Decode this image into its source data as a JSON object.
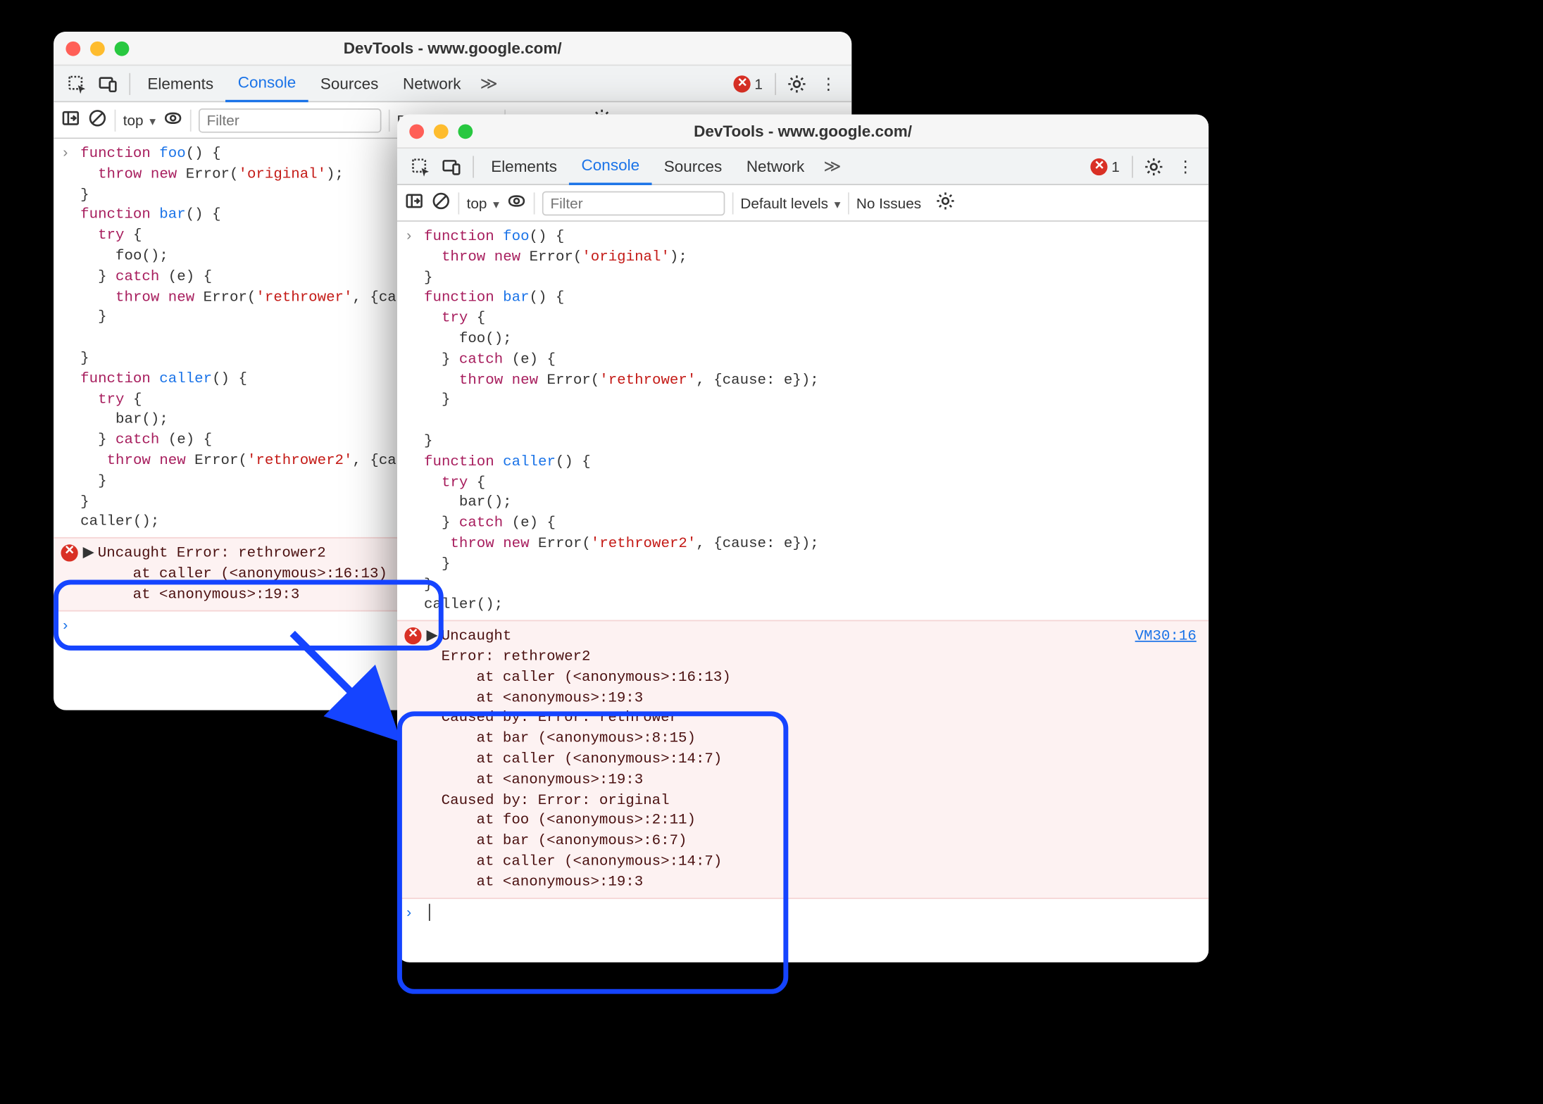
{
  "window_title": "DevTools - www.google.com/",
  "tabs": {
    "elements": "Elements",
    "console": "Console",
    "sources": "Sources",
    "network": "Network"
  },
  "error_count": "1",
  "filterbar": {
    "context": "top",
    "filter_placeholder": "Filter",
    "levels": "Default levels",
    "issues": "No Issues"
  },
  "code": {
    "l01": "function foo() {",
    "l02": "  throw new Error('original');",
    "l03": "}",
    "l04": "function bar() {",
    "l05": "  try {",
    "l06": "    foo();",
    "l07": "  } catch (e) {",
    "l08": "    throw new Error('rethrower', {cause: e});",
    "l09": "  }",
    "l10": "",
    "l11": "}",
    "l12": "function caller() {",
    "l13": "  try {",
    "l14": "    bar();",
    "l15": "  } catch (e) {",
    "l16": "   throw new Error('rethrower2', {cause: e});",
    "l17": "  }",
    "l18": "}",
    "l19": "caller();"
  },
  "error_left": {
    "line1": "Uncaught Error: rethrower2",
    "line2": "    at caller (<anonymous>:16:13)",
    "line3": "    at <anonymous>:19:3"
  },
  "error_right": {
    "link": "VM30:16",
    "line01": "Uncaught ",
    "line02": "Error: rethrower2",
    "line03": "    at caller (<anonymous>:16:13)",
    "line04": "    at <anonymous>:19:3",
    "line05": "Caused by: Error: rethrower",
    "line06": "    at bar (<anonymous>:8:15)",
    "line07": "    at caller (<anonymous>:14:7)",
    "line08": "    at <anonymous>:19:3",
    "line09": "Caused by: Error: original",
    "line10": "    at foo (<anonymous>:2:11)",
    "line11": "    at bar (<anonymous>:6:7)",
    "line12": "    at caller (<anonymous>:14:7)",
    "line13": "    at <anonymous>:19:3"
  }
}
